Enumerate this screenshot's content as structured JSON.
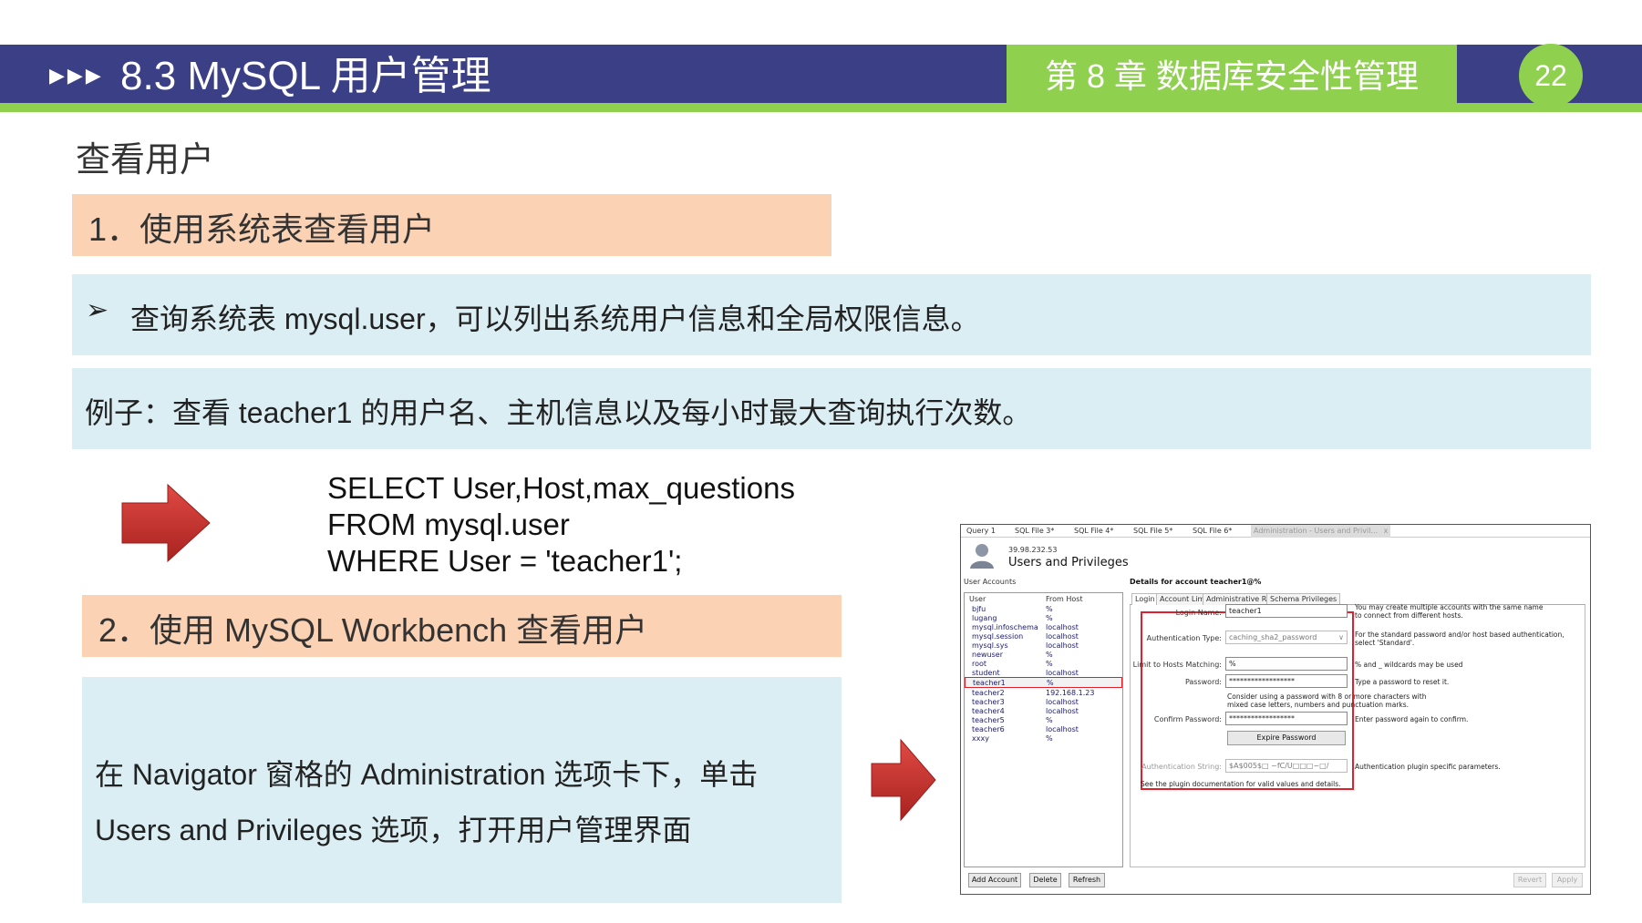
{
  "header": {
    "arrows": "▶▶▶",
    "title": "8.3  MySQL 用户管理",
    "chapter": "第 8 章   数据库安全性管理",
    "page_number": "22"
  },
  "subtitle": "查看用户",
  "section1": {
    "heading": "1．使用系统表查看用户"
  },
  "block1": {
    "bullet": "➢",
    "text": "查询系统表 mysql.user，可以列出系统用户信息和全局权限信息。"
  },
  "block2": {
    "text": "例子：查看 teacher1 的用户名、主机信息以及每小时最大查询执行次数。"
  },
  "sql": {
    "line1": "SELECT User,Host,max_questions",
    "line2": "FROM mysql.user",
    "line3": "WHERE User = 'teacher1';"
  },
  "section2": {
    "heading": "2．使用 MySQL Workbench 查看用户"
  },
  "block3": {
    "line1": "在 Navigator 窗格的 Administration 选项卡下，单击",
    "line2": "Users and Privileges 选项，打开用户管理界面"
  },
  "colors": {
    "header_blue": "#3b3f86",
    "accent_green": "#8fd14f",
    "section_orange": "#fbd3b4",
    "block_blue": "#dbeef3",
    "arrow_red": "#c9302c",
    "highlight_red": "#e0202a"
  },
  "workbench": {
    "tabs": [
      "Query 1",
      "SQL File 3*",
      "SQL File 4*",
      "SQL File 5*",
      "SQL File 6*",
      "Administration - Users and Privil..."
    ],
    "tab_close": "x",
    "server_ip": "39.98.232.53",
    "panel_title": "Users and Privileges",
    "user_accounts_label": "User Accounts",
    "details_label": "Details for account teacher1@%",
    "columns": [
      "User",
      "From Host"
    ],
    "users": [
      {
        "user": "bjfu",
        "host": "%"
      },
      {
        "user": "lugang",
        "host": "%"
      },
      {
        "user": "mysql.infoschema",
        "host": "localhost"
      },
      {
        "user": "mysql.session",
        "host": "localhost"
      },
      {
        "user": "mysql.sys",
        "host": "localhost"
      },
      {
        "user": "newuser",
        "host": "%"
      },
      {
        "user": "root",
        "host": "%"
      },
      {
        "user": "student",
        "host": "localhost"
      },
      {
        "user": "teacher1",
        "host": "%"
      },
      {
        "user": "teacher2",
        "host": "192.168.1.23"
      },
      {
        "user": "teacher3",
        "host": "localhost"
      },
      {
        "user": "teacher4",
        "host": "localhost"
      },
      {
        "user": "teacher5",
        "host": "%"
      },
      {
        "user": "teacher6",
        "host": "localhost"
      },
      {
        "user": "xxxy",
        "host": "%"
      }
    ],
    "selected_user": "teacher1",
    "detail_tabs": [
      "Login",
      "Account Limits",
      "Administrative Roles",
      "Schema Privileges"
    ],
    "login": {
      "login_name_label": "Login Name:",
      "login_name_value": "teacher1",
      "login_name_hint1": "You may create multiple accounts with the same name",
      "login_name_hint2": "to connect from different hosts.",
      "auth_type_label": "Authentication Type:",
      "auth_type_value": "caching_sha2_password",
      "auth_type_hint1": "For the standard password and/or host based authentication,",
      "auth_type_hint2": "select 'Standard'.",
      "host_label": "Limit to Hosts Matching:",
      "host_value": "%",
      "host_hint": "% and _ wildcards may be used",
      "password_label": "Password:",
      "password_value": "******************",
      "password_hint": "Type a password to reset it.",
      "consider_note1": "Consider using a password with 8 or more characters with",
      "consider_note2": "mixed case letters, numbers and punctuation marks.",
      "confirm_label": "Confirm Password:",
      "confirm_value": "******************",
      "confirm_hint": "Enter password again to confirm.",
      "expire_button": "Expire Password",
      "auth_string_label": "Authentication String:",
      "auth_string_value": "$A$005$□          ~fC/U□□□~□/",
      "auth_string_hint": "Authentication plugin specific parameters.",
      "plugin_note": "See the plugin documentation for valid values and details."
    },
    "buttons": {
      "add_account": "Add Account",
      "delete": "Delete",
      "refresh": "Refresh",
      "revert": "Revert",
      "apply": "Apply"
    }
  }
}
